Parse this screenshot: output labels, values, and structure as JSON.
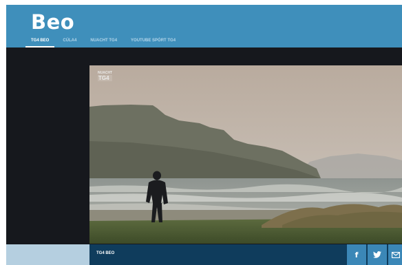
{
  "header": {
    "logo": "Beo",
    "nav": [
      {
        "label": "TG4 BEO",
        "active": true
      },
      {
        "label": "CÚLA4",
        "active": false
      },
      {
        "label": "NUACHT TG4",
        "active": false
      },
      {
        "label": "YOUTUBE SPÓRT TG4",
        "active": false
      }
    ]
  },
  "player": {
    "watermark_top": "NUACHT",
    "watermark_logo": "TG4",
    "caption": "TG4 BEO"
  },
  "share": {
    "facebook_glyph": "f",
    "twitter_icon": "twitter-bird-icon",
    "mail_icon": "mail-icon"
  },
  "colors": {
    "header": "#3f8fbb",
    "bottom_bar": "#0f3c5c",
    "share_button": "#3b87b7"
  }
}
